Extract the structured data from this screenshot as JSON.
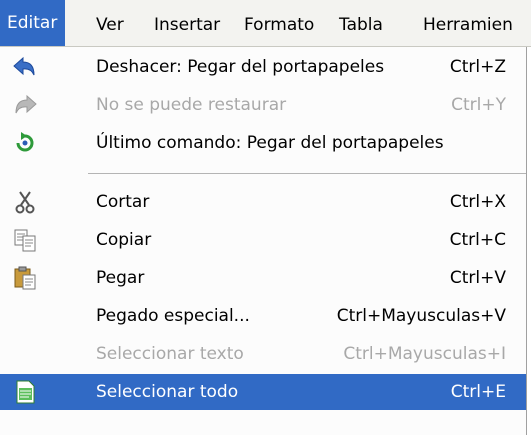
{
  "menubar": {
    "items": [
      {
        "label": "Editar",
        "active": true
      },
      {
        "label": "Ver"
      },
      {
        "label": "Insertar"
      },
      {
        "label": "Formato"
      },
      {
        "label": "Tabla"
      },
      {
        "label": "Herramien"
      }
    ]
  },
  "menu": {
    "items": [
      {
        "label": "Deshacer: Pegar del portapapeles",
        "shortcut": "Ctrl+Z",
        "icon": "undo-icon"
      },
      {
        "label": "No se puede restaurar",
        "shortcut": "Ctrl+Y",
        "icon": "redo-icon",
        "disabled": true
      },
      {
        "label": "Último comando: Pegar del portapapeles",
        "shortcut": "",
        "icon": "repeat-icon"
      },
      {
        "label": "Cortar",
        "shortcut": "Ctrl+X",
        "icon": "cut-icon"
      },
      {
        "label": "Copiar",
        "shortcut": "Ctrl+C",
        "icon": "copy-icon"
      },
      {
        "label": "Pegar",
        "shortcut": "Ctrl+V",
        "icon": "paste-icon"
      },
      {
        "label": "Pegado especial...",
        "shortcut": "Ctrl+Mayusculas+V",
        "icon": ""
      },
      {
        "label": "Seleccionar texto",
        "shortcut": "Ctrl+Mayusculas+I",
        "icon": "",
        "disabled": true
      },
      {
        "label": "Seleccionar todo",
        "shortcut": "Ctrl+E",
        "icon": "select-all-icon",
        "selected": true
      }
    ]
  },
  "colors": {
    "highlight": "#316ac5",
    "undo_icon": "#3a6fc6",
    "disabled_text": "#a8a8a8"
  }
}
